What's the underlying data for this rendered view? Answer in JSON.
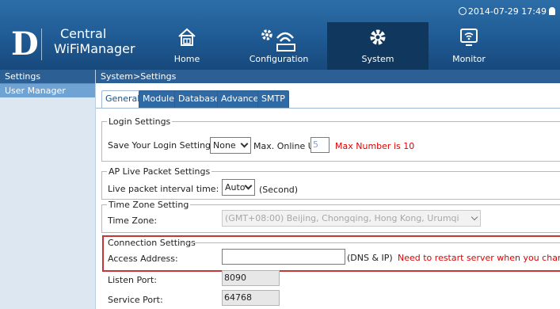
{
  "header": {
    "datetime": "2014-07-29 17:49",
    "logo_letter": "D",
    "logo_line1": "Central",
    "logo_line2": "WiFiManager",
    "nav": [
      {
        "label": "Home",
        "icon": "home-icon"
      },
      {
        "label": "Configuration",
        "icon": "configuration-icon"
      },
      {
        "label": "System",
        "icon": "gear-icon",
        "active": true
      },
      {
        "label": "Monitor",
        "icon": "monitor-icon"
      }
    ]
  },
  "sidebar": {
    "header": "Settings",
    "items": [
      {
        "label": "User Manager"
      }
    ]
  },
  "breadcrumb": "System>Settings",
  "tabs": [
    {
      "label": "General",
      "active": true
    },
    {
      "label": "Module"
    },
    {
      "label": "Database"
    },
    {
      "label": "Advanced"
    },
    {
      "label": "SMTP"
    }
  ],
  "login": {
    "legend": "Login Settings",
    "save_label": "Save Your Login Settings:",
    "save_value": "None",
    "max_label": "Max. Online User:",
    "max_value": "5",
    "max_note": "Max Number is 10"
  },
  "ap_live": {
    "legend": "AP Live Packet Settings",
    "interval_label": "Live packet interval time:",
    "interval_value": "Auto",
    "interval_unit": "(Second)"
  },
  "timezone": {
    "legend": "Time Zone Setting",
    "label": "Time Zone:",
    "value": "(GMT+08:00) Beijing, Chongqing, Hong Kong, Urumqi"
  },
  "connection": {
    "legend": "Connection Settings",
    "access_label": "Access Address:",
    "access_value": "",
    "access_hint": "(DNS & IP)",
    "access_note": "Need to restart server when you change",
    "listen_label": "Listen Port:",
    "listen_value": "8090",
    "service_label": "Service Port:",
    "service_value": "64768"
  },
  "colors": {
    "header_blue": "#1f5a93",
    "active_tab_bg": "#10375d",
    "sidebar_item": "#6ea3d4",
    "warning_red": "#e00000",
    "highlight_border": "#c73535"
  }
}
